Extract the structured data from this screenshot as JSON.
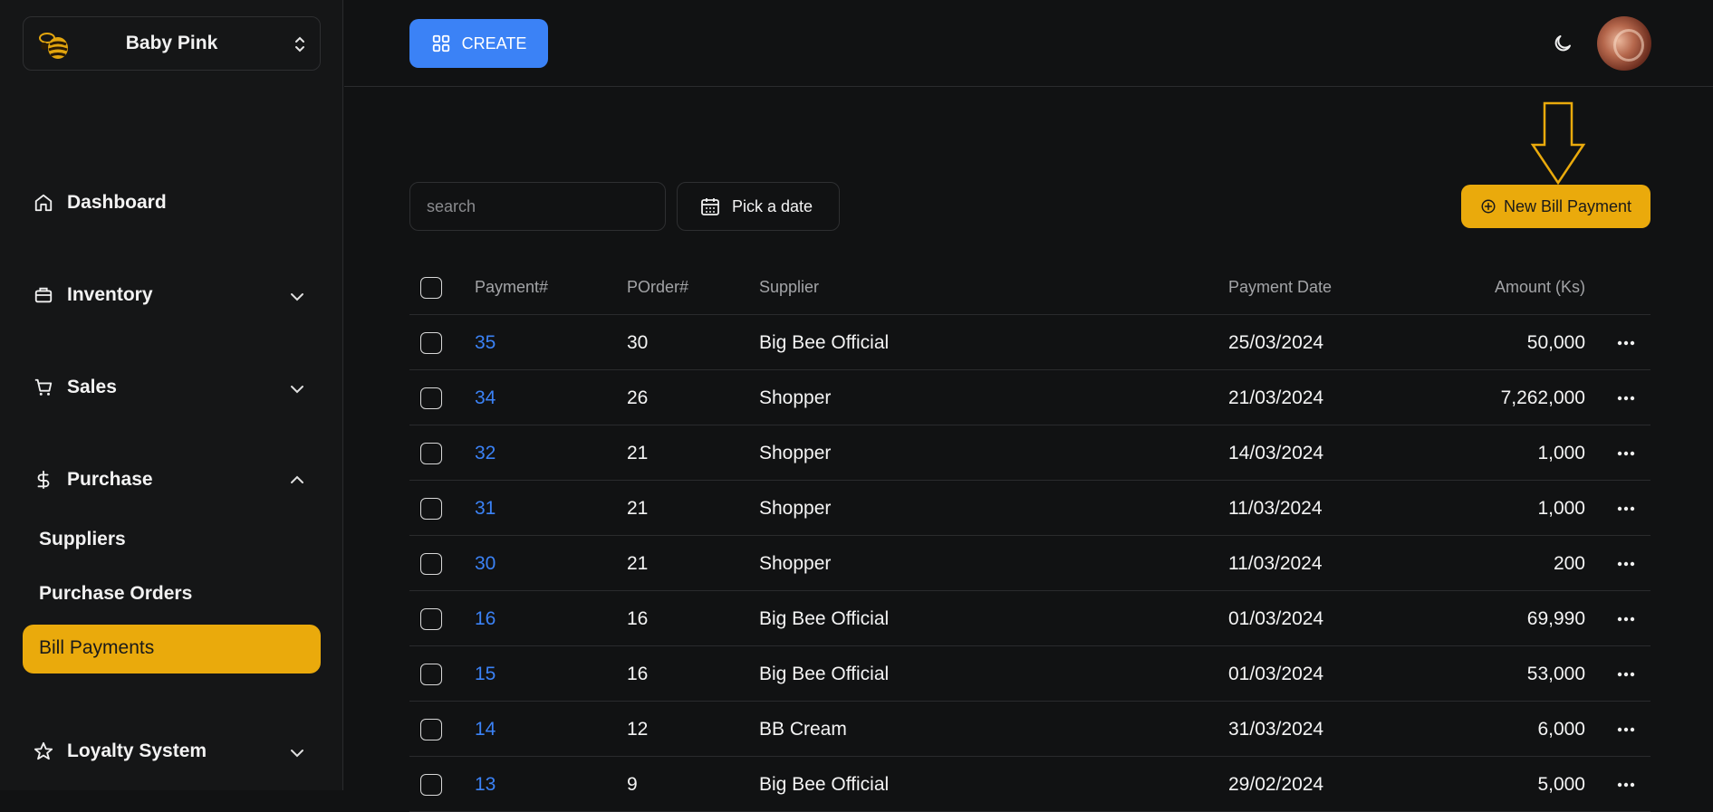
{
  "store": {
    "name": "Baby Pink"
  },
  "sidebar": {
    "items": [
      {
        "label": "Dashboard"
      },
      {
        "label": "Inventory"
      },
      {
        "label": "Sales"
      },
      {
        "label": "Purchase"
      },
      {
        "label": "Loyalty System"
      }
    ],
    "purchase_sub": [
      {
        "label": "Suppliers"
      },
      {
        "label": "Purchase Orders"
      },
      {
        "label": "Bill Payments"
      }
    ]
  },
  "topbar": {
    "create_label": "CREATE"
  },
  "toolbar": {
    "search_placeholder": "search",
    "date_label": "Pick a date",
    "new_label": "New Bill Payment"
  },
  "table": {
    "headers": {
      "payment": "Payment#",
      "porder": "POrder#",
      "supplier": "Supplier",
      "date": "Payment Date",
      "amount": "Amount (Ks)"
    },
    "rows": [
      {
        "payment": "35",
        "porder": "30",
        "supplier": "Big Bee Official",
        "date": "25/03/2024",
        "amount": "50,000"
      },
      {
        "payment": "34",
        "porder": "26",
        "supplier": "Shopper",
        "date": "21/03/2024",
        "amount": "7,262,000"
      },
      {
        "payment": "32",
        "porder": "21",
        "supplier": "Shopper",
        "date": "14/03/2024",
        "amount": "1,000"
      },
      {
        "payment": "31",
        "porder": "21",
        "supplier": "Shopper",
        "date": "11/03/2024",
        "amount": "1,000"
      },
      {
        "payment": "30",
        "porder": "21",
        "supplier": "Shopper",
        "date": "11/03/2024",
        "amount": "200"
      },
      {
        "payment": "16",
        "porder": "16",
        "supplier": "Big Bee Official",
        "date": "01/03/2024",
        "amount": "69,990"
      },
      {
        "payment": "15",
        "porder": "16",
        "supplier": "Big Bee Official",
        "date": "01/03/2024",
        "amount": "53,000"
      },
      {
        "payment": "14",
        "porder": "12",
        "supplier": "BB Cream",
        "date": "31/03/2024",
        "amount": "6,000"
      },
      {
        "payment": "13",
        "porder": "9",
        "supplier": "Big Bee Official",
        "date": "29/02/2024",
        "amount": "5,000"
      }
    ]
  },
  "colors": {
    "accent": "#eaaa0c",
    "link": "#3b82f6",
    "background": "#111213"
  }
}
